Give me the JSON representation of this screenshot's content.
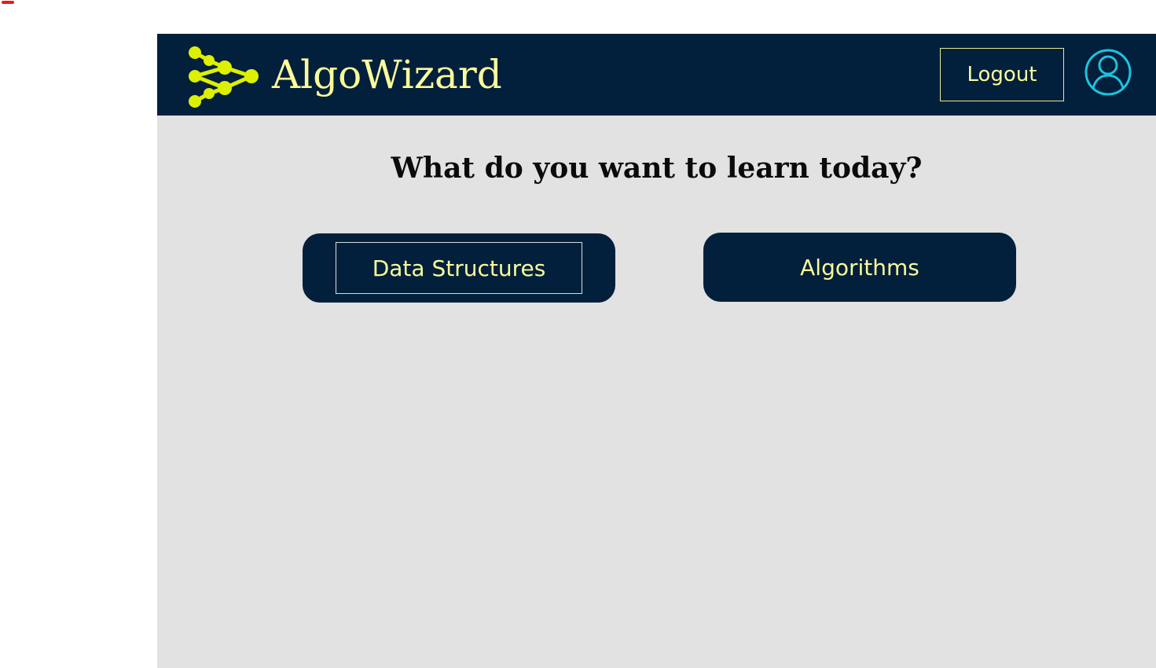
{
  "app": {
    "brand_name": "AlgoWizard",
    "logo_icon": "network-graph-icon",
    "profile_icon": "user-circle-icon"
  },
  "header": {
    "logout_label": "Logout"
  },
  "main": {
    "question": "What do you want to learn today?",
    "choices": [
      {
        "label": "Data Structures",
        "focused": true
      },
      {
        "label": "Algorithms",
        "focused": false
      }
    ]
  },
  "colors": {
    "navy": "#02203c",
    "accent_yellow": "#fbfb9a",
    "logo_green": "#ddf000",
    "profile_cyan": "#1cc4e0",
    "background": "#e2e2e2"
  }
}
